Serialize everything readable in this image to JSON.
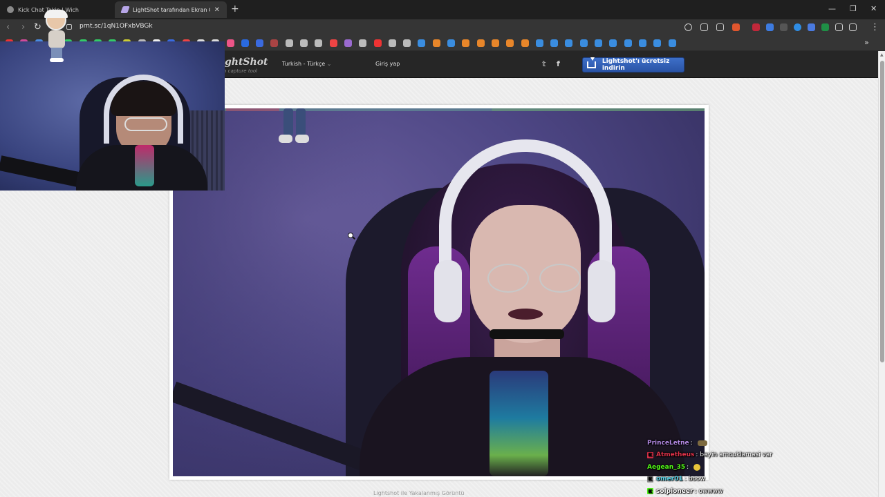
{
  "browser": {
    "tabs": [
      {
        "title": "Kick Chat Takip | Wich",
        "active": false
      },
      {
        "title": "LightShot tarafından Ekran Görü",
        "active": true
      }
    ],
    "new_tab_symbol": "+",
    "close_symbol": "✕",
    "window_controls": {
      "minimize": "—",
      "restore": "❐",
      "close": "✕"
    },
    "address": "prnt.sc/1qN1OFxbVBGk",
    "bookmarks_overflow": "»"
  },
  "site": {
    "logo_text": "LightShot",
    "logo_visible": "ghtShot",
    "logo_sub": "n capture tool",
    "language": "Turkish - Türkçe",
    "language_caret": "⌄",
    "login": "Giriş yap",
    "twitter_icon": "𝕥",
    "facebook_icon": "f",
    "download_button": "Lightshot'ı ücretsiz indirin",
    "footer": "Lightshot ile Yakalanmış Görüntü"
  },
  "chat": [
    {
      "user": "PrinceLetne",
      "sep": ":",
      "message": "",
      "emote": "cigar",
      "badge": "",
      "badge_color": "#8f8f8f",
      "user_color": "#b58ae6"
    },
    {
      "user": "Atmetheus",
      "sep": ":",
      "message": "beyin amcuklamasi var",
      "emote": "",
      "badge": "K",
      "badge_color": "#e0324a",
      "user_color": "#e0324a"
    },
    {
      "user": "Aegean_35",
      "sep": ":",
      "message": "",
      "emote": "yellow-face",
      "badge": "",
      "badge_color": "#53fc18",
      "user_color": "#53fc18"
    },
    {
      "user": "omer01",
      "sep": ":",
      "message": "boow",
      "emote": "",
      "badge": "K",
      "badge_color": "#8f8f8f",
      "user_color": "#5ad2e8"
    },
    {
      "user": "solpioneer",
      "sep": ":",
      "message": "owwww",
      "emote": "",
      "badge": "K",
      "badge_color": "#53fc18",
      "user_color": "#ffffff"
    }
  ],
  "colors": {
    "accent_blue": "#2a54a6",
    "kick_green": "#53fc18",
    "page_bg": "#ececec",
    "header_bg": "#262626"
  }
}
